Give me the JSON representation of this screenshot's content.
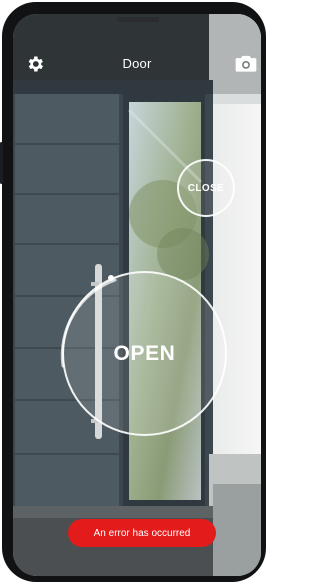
{
  "header": {
    "title": "Door",
    "settings_icon": "gear-icon",
    "camera_icon": "camera-icon"
  },
  "controls": {
    "close_label": "CLOSE",
    "open_label": "OPEN"
  },
  "toast": {
    "message": "An error has occurred"
  },
  "colors": {
    "toast_bg": "#e41b1b",
    "accent": "#ffffff"
  }
}
